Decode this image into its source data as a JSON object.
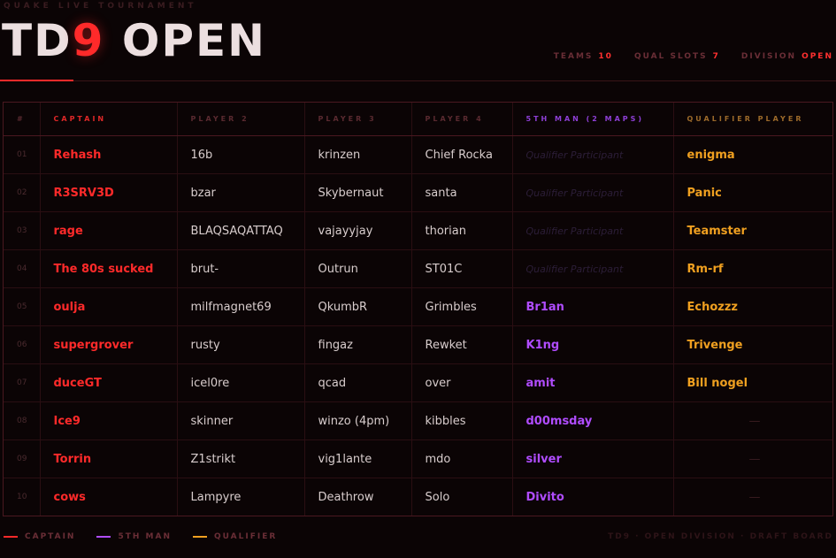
{
  "header": {
    "kicker": "QUAKE LIVE TOURNAMENT",
    "title_prefix": "TD",
    "title_accent": "9",
    "title_suffix": " OPEN"
  },
  "stats": [
    {
      "label": "TEAMS",
      "value": "10"
    },
    {
      "label": "QUAL SLOTS",
      "value": "7"
    },
    {
      "label": "DIVISION",
      "value": "OPEN"
    }
  ],
  "columns": {
    "num": "#",
    "captain": "CAPTAIN",
    "player2": "PLAYER 2",
    "player3": "PLAYER 3",
    "player4": "PLAYER 4",
    "fifth": "5TH MAN (2 MAPS)",
    "qualifier": "QUALIFIER PLAYER"
  },
  "rows": [
    {
      "num": "01",
      "captain": "Rehash",
      "player2": "16b",
      "player3": "krinzen",
      "player4": "Chief Rocka",
      "fifth": "Qualifier Participant",
      "fifth_placeholder": true,
      "qualifier": "enigma"
    },
    {
      "num": "02",
      "captain": "R3SRV3D",
      "player2": "bzar",
      "player3": "Skybernaut",
      "player4": "santa",
      "fifth": "Qualifier Participant",
      "fifth_placeholder": true,
      "qualifier": "Panic"
    },
    {
      "num": "03",
      "captain": "rage",
      "player2": "BLAQSAQATTAQ",
      "player3": "vajayyjay",
      "player4": "thorian",
      "fifth": "Qualifier Participant",
      "fifth_placeholder": true,
      "qualifier": "Teamster"
    },
    {
      "num": "04",
      "captain": "The 80s sucked",
      "player2": "brut-",
      "player3": "Outrun",
      "player4": "ST01C",
      "fifth": "Qualifier Participant",
      "fifth_placeholder": true,
      "qualifier": "Rm-rf"
    },
    {
      "num": "05",
      "captain": "oulja",
      "player2": "milfmagnet69",
      "player3": "QkumbR",
      "player4": "Grimbles",
      "fifth": "Br1an",
      "fifth_placeholder": false,
      "qualifier": "Echozzz"
    },
    {
      "num": "06",
      "captain": "supergrover",
      "player2": "rusty",
      "player3": "fingaz",
      "player4": "Rewket",
      "fifth": "K1ng",
      "fifth_placeholder": false,
      "qualifier": "Trivenge"
    },
    {
      "num": "07",
      "captain": "duceGT",
      "player2": "icel0re",
      "player3": "qcad",
      "player4": "over",
      "fifth": "amit",
      "fifth_placeholder": false,
      "qualifier": "Bill nogel"
    },
    {
      "num": "08",
      "captain": "Ice9",
      "player2": "skinner",
      "player3": "winzo (4pm)",
      "player4": "kibbles",
      "fifth": "d00msday",
      "fifth_placeholder": false,
      "qualifier": "—"
    },
    {
      "num": "09",
      "captain": "Torrin",
      "player2": "Z1strikt",
      "player3": "vig1lante",
      "player4": "mdo",
      "fifth": "silver",
      "fifth_placeholder": false,
      "qualifier": "—"
    },
    {
      "num": "10",
      "captain": "cows",
      "player2": "Lampyre",
      "player3": "Deathrow",
      "player4": "Solo",
      "fifth": "Divito",
      "fifth_placeholder": false,
      "qualifier": "—"
    }
  ],
  "legend": [
    {
      "label": "CAPTAIN",
      "color": "#ff2a2a"
    },
    {
      "label": "5TH MAN",
      "color": "#b04cff"
    },
    {
      "label": "QUALIFIER",
      "color": "#f0a020"
    }
  ],
  "footer_note": "TD9 · OPEN DIVISION · DRAFT BOARD"
}
